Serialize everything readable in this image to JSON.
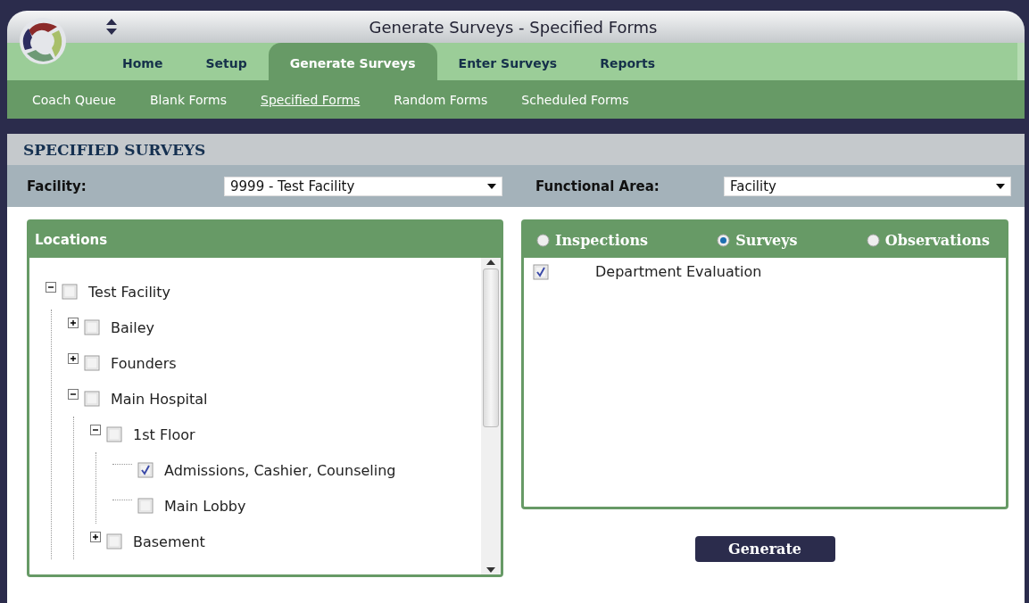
{
  "window": {
    "title": "Generate Surveys - Specified Forms"
  },
  "tabs": [
    {
      "label": "Home",
      "selected": false
    },
    {
      "label": "Setup",
      "selected": false
    },
    {
      "label": "Generate Surveys",
      "selected": true
    },
    {
      "label": "Enter Surveys",
      "selected": false
    },
    {
      "label": "Reports",
      "selected": false
    }
  ],
  "subnav": [
    {
      "label": "Coach Queue",
      "selected": false
    },
    {
      "label": "Blank Forms",
      "selected": false
    },
    {
      "label": "Specified Forms",
      "selected": true
    },
    {
      "label": "Random Forms",
      "selected": false
    },
    {
      "label": "Scheduled Forms",
      "selected": false
    }
  ],
  "section_title": "SPECIFIED SURVEYS",
  "filters": [
    {
      "label": "Facility:",
      "value": "9999 - Test Facility"
    },
    {
      "label": "Functional Area:",
      "value": "Facility"
    }
  ],
  "locations": {
    "title": "Locations",
    "tree": [
      {
        "label": "Test Facility",
        "checked": false,
        "expanded": true,
        "children": [
          {
            "label": "Bailey",
            "checked": false,
            "expanded": false
          },
          {
            "label": "Founders",
            "checked": false,
            "expanded": false
          },
          {
            "label": "Main Hospital",
            "checked": false,
            "expanded": true,
            "children": [
              {
                "label": "1st Floor",
                "checked": false,
                "expanded": true,
                "children": [
                  {
                    "label": "Admissions, Cashier, Counseling",
                    "checked": true
                  },
                  {
                    "label": "Main Lobby",
                    "checked": false
                  }
                ]
              },
              {
                "label": "Basement",
                "checked": false,
                "expanded": false
              }
            ]
          }
        ]
      }
    ]
  },
  "form_types": [
    {
      "label": "Inspections",
      "selected": false
    },
    {
      "label": "Surveys",
      "selected": true
    },
    {
      "label": "Observations",
      "selected": false
    }
  ],
  "forms": [
    {
      "label": "Department Evaluation",
      "checked": true
    }
  ],
  "generate_button": "Generate"
}
